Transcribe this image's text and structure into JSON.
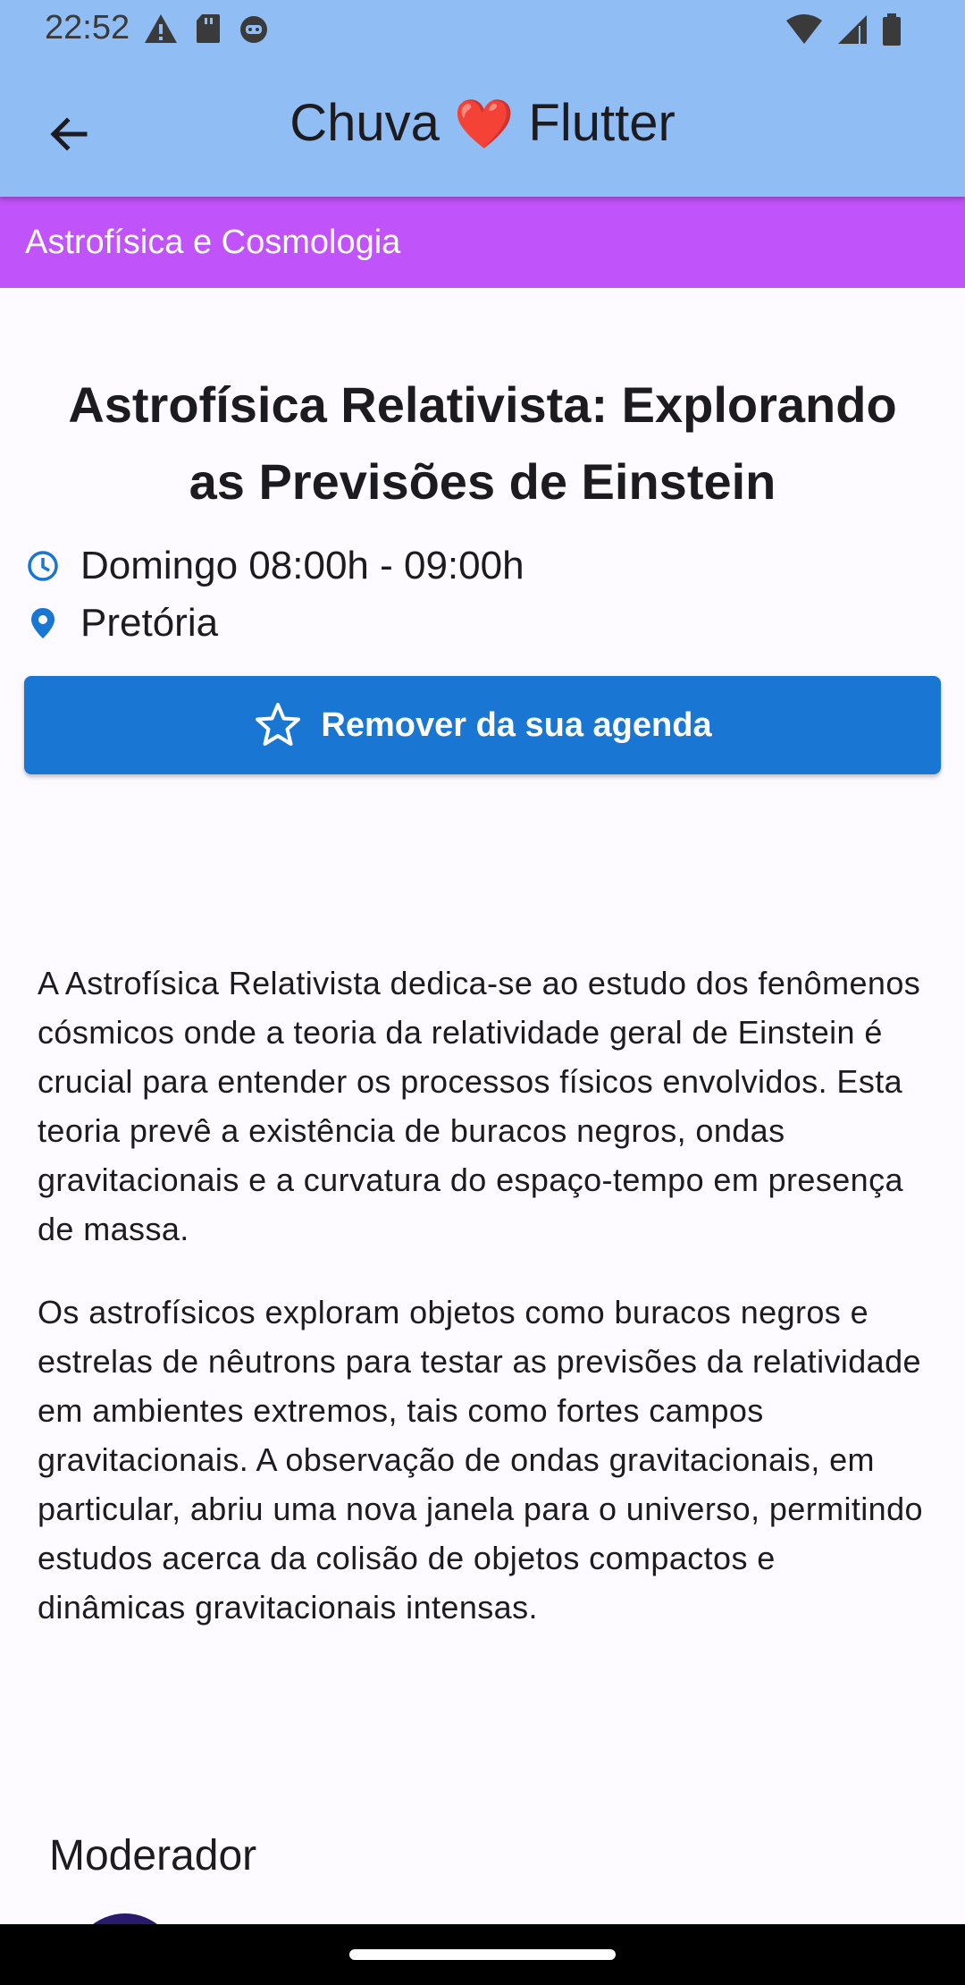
{
  "status_bar": {
    "time": "22:52",
    "left_icons": [
      "alert-icon",
      "sd-card-icon",
      "robot-icon"
    ],
    "right_icons": [
      "wifi-icon",
      "signal-icon",
      "battery-icon"
    ]
  },
  "app_bar": {
    "title_prefix": "Chuva",
    "title_heart": "❤️",
    "title_suffix": "Flutter",
    "background": "#90bdf4"
  },
  "category": {
    "label": "Astrofísica e Cosmologia",
    "color": "#c153fa"
  },
  "activity": {
    "title": "Astrofísica Relativista: Explorando as Previsões de Einstein",
    "time": "Domingo 08:00h - 09:00h",
    "location": "Pretória",
    "agenda_button_label": "Remover da sua agenda",
    "accent_color": "#1976d2",
    "description": [
      "A Astrofísica Relativista dedica-se ao estudo dos fenômenos cósmicos onde a teoria da relatividade geral de Einstein é crucial para entender os processos físicos envolvidos. Esta teoria prevê a existência de buracos negros, ondas gravitacionais e a curvatura do espaço-tempo em presença de massa.",
      "Os astrofísicos exploram objetos como buracos negros e estrelas de nêutrons para testar as previsões da relatividade em ambientes extremos, tais como fortes campos gravitacionais. A observação de ondas gravitacionais, em particular, abriu uma nova janela para o universo, permitindo estudos acerca da colisão de objetos compactos e dinâmicas gravitacionais intensas."
    ]
  },
  "moderator": {
    "heading": "Moderador"
  }
}
